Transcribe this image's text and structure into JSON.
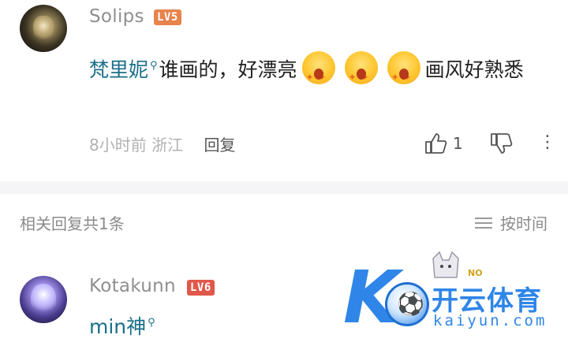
{
  "comment": {
    "username": "Solips",
    "level": "LV5",
    "mention": "梵里妮",
    "text_before": "谁画的，好漂亮",
    "text_after": "画风好熟悉",
    "emoji_name": "starstruck-face-emoji",
    "time": "8小时前",
    "location": "浙江",
    "reply_label": "回复",
    "like_count": "1"
  },
  "related": {
    "label": "相关回复共1条",
    "sort_label": "按时间"
  },
  "reply": {
    "username": "Kotakunn",
    "level": "LV6",
    "text": "min神"
  },
  "watermark": {
    "brand_cn": "开云体育",
    "url": "kaiyun.com",
    "tag": "NO"
  },
  "colors": {
    "mention": "#1b6f8a",
    "level5": "#e8834c",
    "level6": "#e0584a",
    "watermark_blue": "#2f86e8"
  }
}
